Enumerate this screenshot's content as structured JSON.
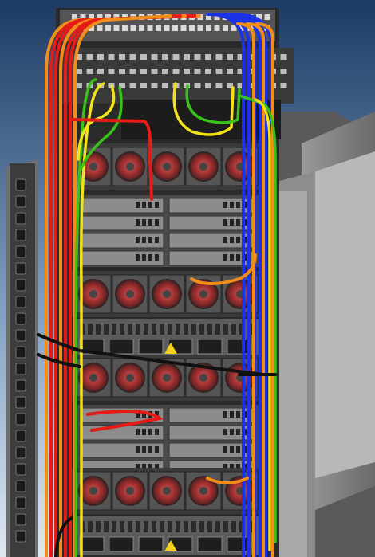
{
  "image": {
    "subject": "server-rack-cabling",
    "colors": {
      "background_top": "#1d3a63",
      "background_bottom": "#dfe8f2",
      "rack_gray": "#7b7b7b",
      "rack_dark": "#2a2a2a",
      "fan_red": "#b63a3a",
      "cable_red": "#e41b17",
      "cable_orange": "#f28c1a",
      "cable_yellow": "#f2e21a",
      "cable_green": "#39c21a",
      "cable_blue": "#1a33e6",
      "cable_black": "#111111"
    }
  }
}
